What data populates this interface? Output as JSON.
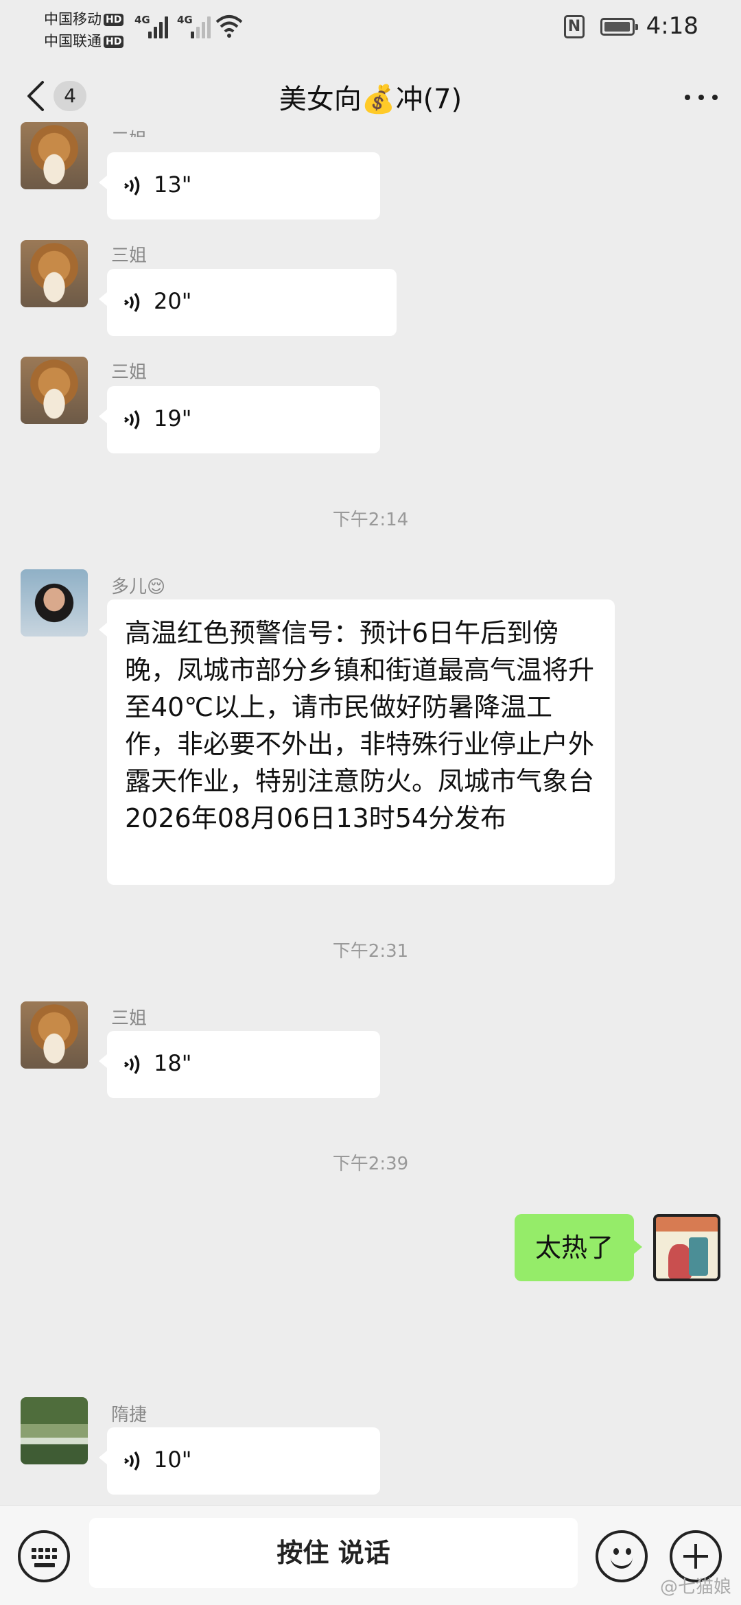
{
  "status_bar": {
    "carrier1": "中国移动",
    "carrier2": "中国联通",
    "hd_label": "HD",
    "network1": "4G",
    "network2": "4G",
    "nfc_label": "N",
    "time": "4:18"
  },
  "header": {
    "back_badge": "4",
    "title": "美女向💰冲(7)"
  },
  "messages": [
    {
      "sender": "三姐",
      "type": "voice",
      "duration": "13\""
    },
    {
      "sender": "三姐",
      "type": "voice",
      "duration": "20\""
    },
    {
      "sender": "三姐",
      "type": "voice",
      "duration": "19\""
    },
    {
      "type": "timestamp",
      "text": "下午2:14"
    },
    {
      "sender": "多儿😌",
      "type": "text",
      "text": "高温红色预警信号：预计6日午后到傍晚，凤城市部分乡镇和街道最高气温将升至40℃以上，请市民做好防暑降温工作，非必要不外出，非特殊行业停止户外露天作业，特别注意防火。凤城市气象台2026年08月06日13时54分发布"
    },
    {
      "type": "timestamp",
      "text": "下午2:31"
    },
    {
      "sender": "三姐",
      "type": "voice",
      "duration": "18\""
    },
    {
      "type": "timestamp",
      "text": "下午2:39"
    },
    {
      "sender": "me",
      "type": "text",
      "text": "太热了"
    },
    {
      "sender": "隋捷",
      "type": "voice",
      "duration": "10\""
    }
  ],
  "input_bar": {
    "hold_to_talk": "按住 说话"
  },
  "watermark": "@七猫娘"
}
